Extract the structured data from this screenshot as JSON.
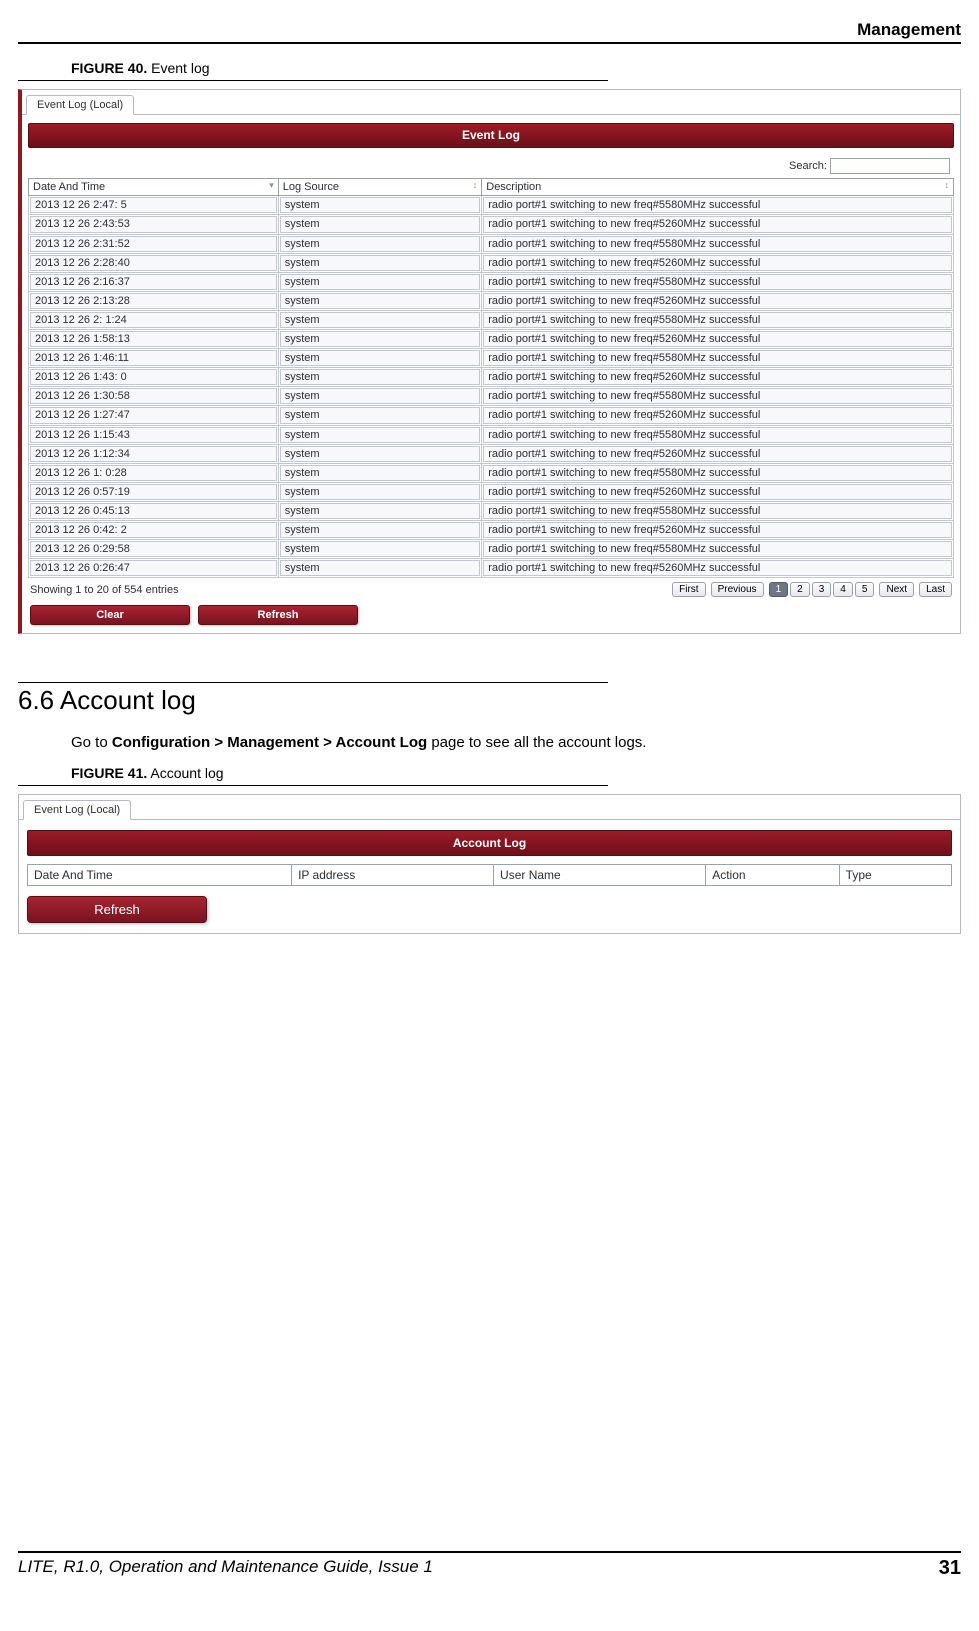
{
  "header": {
    "section": "Management"
  },
  "figure40": {
    "label": "FIGURE 40.",
    "title": "Event log"
  },
  "eventlog": {
    "tab": "Event Log (Local)",
    "bar": "Event Log",
    "search_label": "Search:",
    "search_value": "",
    "columns": [
      "Date And Time",
      "Log Source",
      "Description"
    ],
    "rows": [
      {
        "dt": "2013 12 26  2:47: 5",
        "src": "system",
        "desc": "radio port#1 switching to new freq#5580MHz successful"
      },
      {
        "dt": "2013 12 26  2:43:53",
        "src": "system",
        "desc": "radio port#1 switching to new freq#5260MHz successful"
      },
      {
        "dt": "2013 12 26  2:31:52",
        "src": "system",
        "desc": "radio port#1 switching to new freq#5580MHz successful"
      },
      {
        "dt": "2013 12 26  2:28:40",
        "src": "system",
        "desc": "radio port#1 switching to new freq#5260MHz successful"
      },
      {
        "dt": "2013 12 26  2:16:37",
        "src": "system",
        "desc": "radio port#1 switching to new freq#5580MHz successful"
      },
      {
        "dt": "2013 12 26  2:13:28",
        "src": "system",
        "desc": "radio port#1 switching to new freq#5260MHz successful"
      },
      {
        "dt": "2013 12 26  2: 1:24",
        "src": "system",
        "desc": "radio port#1 switching to new freq#5580MHz successful"
      },
      {
        "dt": "2013 12 26  1:58:13",
        "src": "system",
        "desc": "radio port#1 switching to new freq#5260MHz successful"
      },
      {
        "dt": "2013 12 26  1:46:11",
        "src": "system",
        "desc": "radio port#1 switching to new freq#5580MHz successful"
      },
      {
        "dt": "2013 12 26  1:43: 0",
        "src": "system",
        "desc": "radio port#1 switching to new freq#5260MHz successful"
      },
      {
        "dt": "2013 12 26  1:30:58",
        "src": "system",
        "desc": "radio port#1 switching to new freq#5580MHz successful"
      },
      {
        "dt": "2013 12 26  1:27:47",
        "src": "system",
        "desc": "radio port#1 switching to new freq#5260MHz successful"
      },
      {
        "dt": "2013 12 26  1:15:43",
        "src": "system",
        "desc": "radio port#1 switching to new freq#5580MHz successful"
      },
      {
        "dt": "2013 12 26  1:12:34",
        "src": "system",
        "desc": "radio port#1 switching to new freq#5260MHz successful"
      },
      {
        "dt": "2013 12 26  1: 0:28",
        "src": "system",
        "desc": "radio port#1 switching to new freq#5580MHz successful"
      },
      {
        "dt": "2013 12 26  0:57:19",
        "src": "system",
        "desc": "radio port#1 switching to new freq#5260MHz successful"
      },
      {
        "dt": "2013 12 26  0:45:13",
        "src": "system",
        "desc": "radio port#1 switching to new freq#5580MHz successful"
      },
      {
        "dt": "2013 12 26  0:42: 2",
        "src": "system",
        "desc": "radio port#1 switching to new freq#5260MHz successful"
      },
      {
        "dt": "2013 12 26  0:29:58",
        "src": "system",
        "desc": "radio port#1 switching to new freq#5580MHz successful"
      },
      {
        "dt": "2013 12 26  0:26:47",
        "src": "system",
        "desc": "radio port#1 switching to new freq#5260MHz successful"
      }
    ],
    "showing": "Showing 1 to 20 of 554 entries",
    "pager": {
      "first": "First",
      "prev": "Previous",
      "pages": [
        "1",
        "2",
        "3",
        "4",
        "5"
      ],
      "active": "1",
      "next": "Next",
      "last": "Last"
    },
    "clear": "Clear",
    "refresh": "Refresh"
  },
  "section66": {
    "heading": "6.6 Account log",
    "body_pre": "Go to ",
    "body_bold": "Configuration > Management > Account Log",
    "body_post": " page to see all the account logs."
  },
  "figure41": {
    "label": "FIGURE 41.",
    "title": "Account log"
  },
  "accountlog": {
    "tab": "Event Log (Local)",
    "bar": "Account Log",
    "columns": [
      "Date And Time",
      "IP address",
      "User Name",
      "Action",
      "Type"
    ],
    "refresh": "Refresh"
  },
  "footer": {
    "doc": "LITE, R1.0, Operation and Maintenance Guide, Issue 1",
    "page": "31"
  }
}
